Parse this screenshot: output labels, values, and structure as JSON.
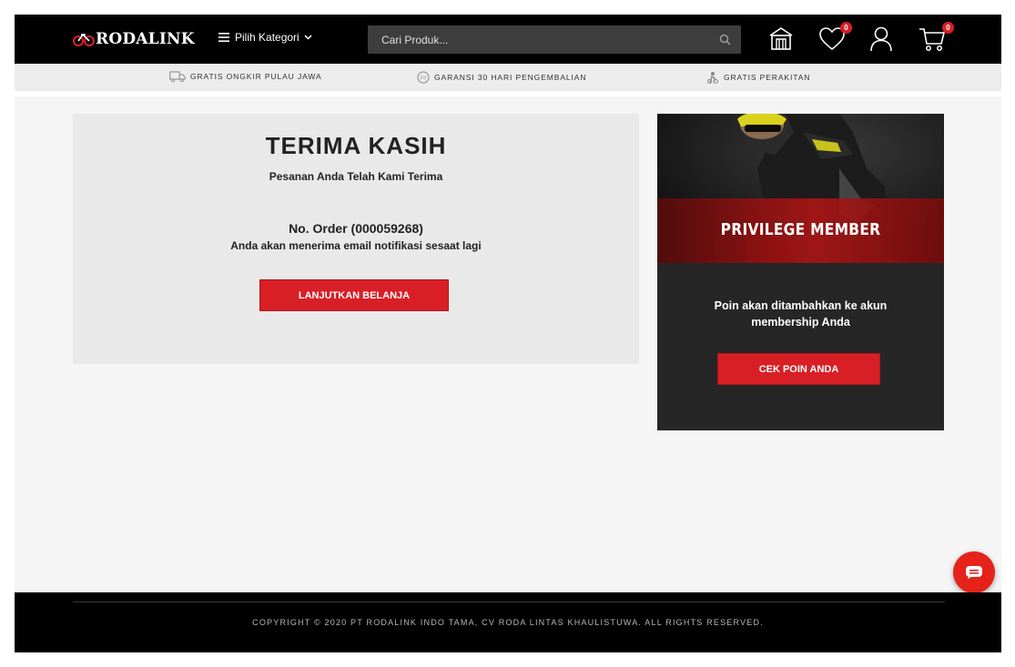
{
  "header": {
    "logo_text": "RODALINK",
    "category_label": "Pilih Kategori",
    "search_placeholder": "Cari Produk...",
    "wishlist_count": "0",
    "cart_count": "0"
  },
  "benefits": [
    {
      "label": "GRATIS ONGKIR PULAU JAWA",
      "icon": "truck-icon"
    },
    {
      "label": "GARANSI 30 HARI PENGEMBALIAN",
      "icon": "30-days-icon"
    },
    {
      "label": "GRATIS PERAKITAN",
      "icon": "bike-assembly-icon"
    }
  ],
  "thanks": {
    "title": "TERIMA KASIH",
    "subtitle": "Pesanan Anda Telah Kami Terima",
    "order_label": "No. Order",
    "order_number": "(000059268)",
    "note": "Anda akan menerima email notifikasi sesaat lagi",
    "continue_button": "LANJUTKAN BELANJA"
  },
  "member": {
    "title": "PRIVILEGE MEMBER",
    "text": "Poin akan ditambahkan ke akun membership Anda",
    "button": "CEK POIN ANDA"
  },
  "footer": {
    "copyright": "COPYRIGHT © 2020 PT RODALINK INDO TAMA, CV RODA LINTAS KHAULISTUWA. ALL RIGHTS RESERVED."
  },
  "colors": {
    "brand_red": "#d81f26",
    "header_bg": "#000000",
    "card_bg": "#e9e9e9",
    "member_bg": "#262626"
  }
}
